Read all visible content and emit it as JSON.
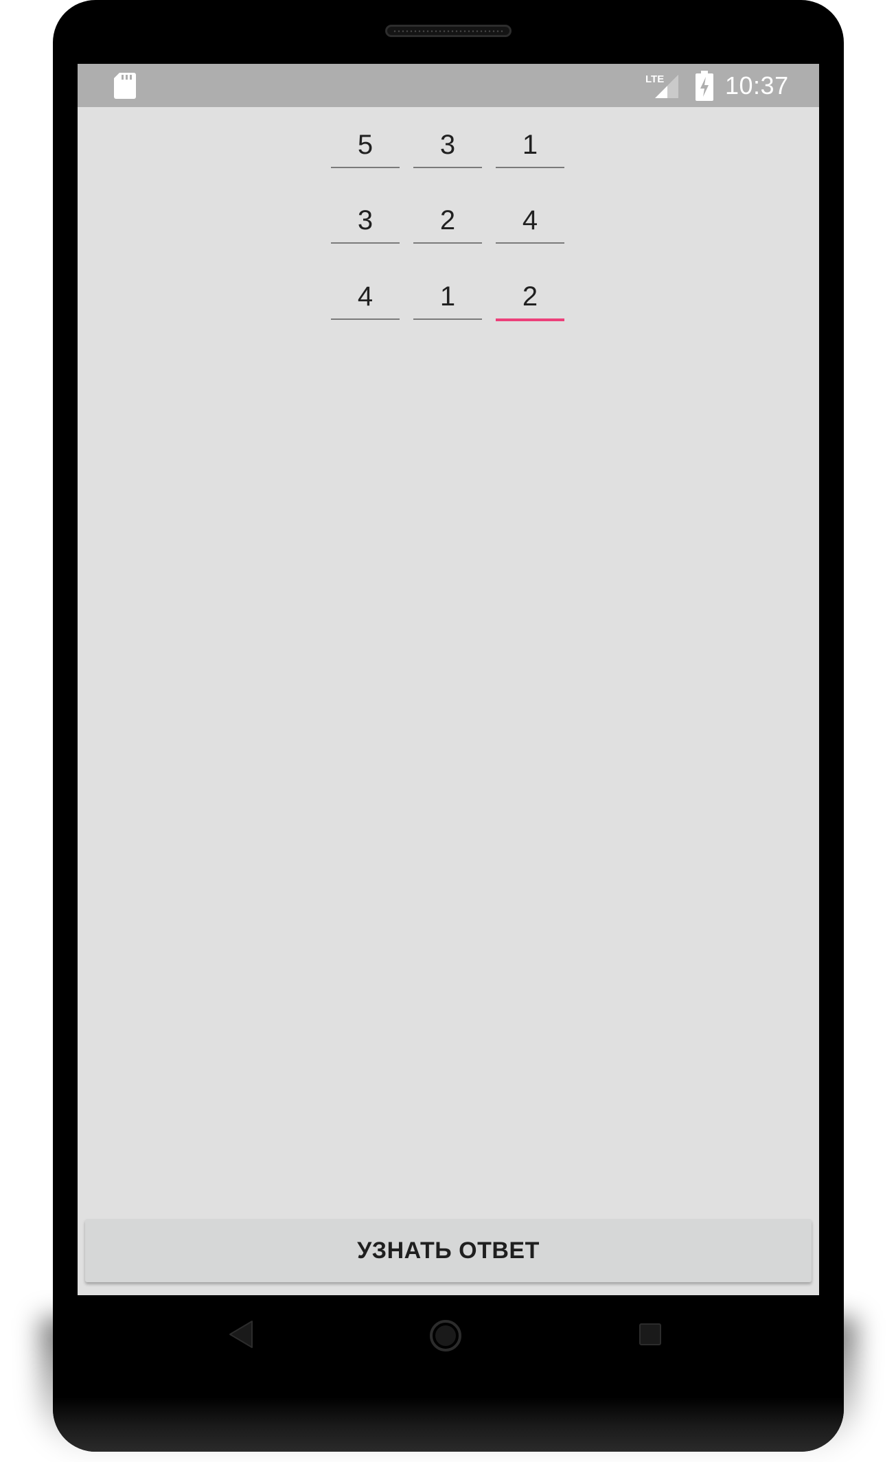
{
  "status_bar": {
    "time": "10:37",
    "network_label": "LTE",
    "icons": [
      "sd-card-icon",
      "lte-signal-icon",
      "battery-charging-icon"
    ]
  },
  "grid": {
    "rows": [
      [
        "5",
        "3",
        "1"
      ],
      [
        "3",
        "2",
        "4"
      ],
      [
        "4",
        "1",
        "2"
      ]
    ],
    "focused_cell": "row 3, column 3"
  },
  "answer_button": {
    "label": "УЗНАТЬ ОТВЕТ"
  },
  "navigation": {
    "icons": [
      "back-icon",
      "home-icon",
      "recent-apps-icon"
    ]
  },
  "colors": {
    "screen_background": "#e0e0e0",
    "status_bar": "#aeaeae",
    "focus_accent": "#ec407a",
    "button": "#d6d7d7"
  }
}
